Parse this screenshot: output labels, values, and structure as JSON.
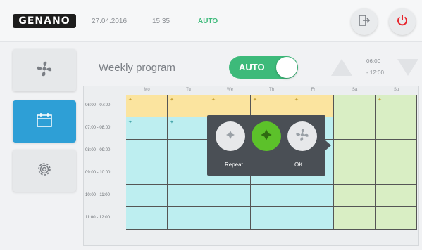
{
  "header": {
    "logo": "GENANO",
    "date": "27.04.2016",
    "time": "15.35",
    "mode": "AUTO"
  },
  "sidebar": {
    "items": [
      {
        "icon": "fan-icon",
        "active": false
      },
      {
        "icon": "calendar-icon",
        "active": true
      },
      {
        "icon": "gear-icon",
        "active": false
      }
    ]
  },
  "program": {
    "title": "Weekly program",
    "toggle_label": "AUTO",
    "range_start": "06:00",
    "range_end": "- 12:00"
  },
  "schedule": {
    "days": [
      "Mo",
      "Tu",
      "We",
      "Th",
      "Fr",
      "Sa",
      "Su"
    ],
    "times": [
      "06:00 - 07:00",
      "07:00 - 08:00",
      "08:00 - 09:00",
      "09:00 - 10:00",
      "10:00 - 11:00",
      "11:00 - 12:00"
    ],
    "colors": {
      "yellow": "#fbe49f",
      "cyan": "#bdeef0",
      "green": "#d9eec4"
    }
  },
  "popup": {
    "repeat_label": "Repeat",
    "ok_label": "OK"
  },
  "colors": {
    "accent_green": "#3dba7a",
    "active_blue": "#2e9fd6",
    "popup_bg": "#4a4f55",
    "confirm_green": "#5cc12a",
    "power_red": "#e8262e"
  }
}
